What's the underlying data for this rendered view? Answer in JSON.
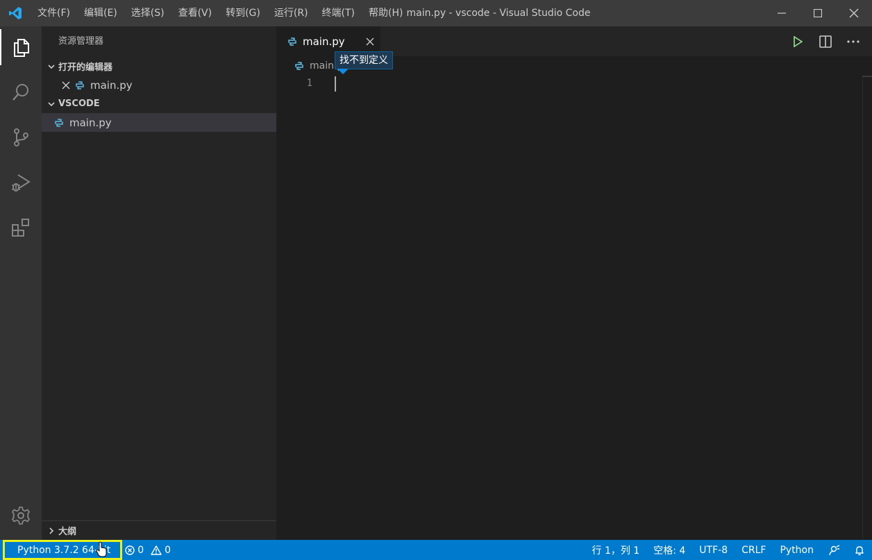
{
  "titlebar": {
    "menu": [
      "文件(F)",
      "编辑(E)",
      "选择(S)",
      "查看(V)",
      "转到(G)",
      "运行(R)",
      "终端(T)",
      "帮助(H)"
    ],
    "window_title": "main.py - vscode - Visual Studio Code"
  },
  "sidebar": {
    "title": "资源管理器",
    "open_editors": {
      "header": "打开的编辑器",
      "files": [
        "main.py"
      ]
    },
    "folder": {
      "header": "VSCODE",
      "files": [
        "main.py"
      ]
    },
    "outline_header": "大纲"
  },
  "editor": {
    "tab_label": "main.py",
    "breadcrumb": "main.py",
    "line_number": "1",
    "tooltip": "找不到定义"
  },
  "statusbar": {
    "interpreter": "Python 3.7.2 64-bit",
    "errors": "0",
    "warnings": "0",
    "position": "行 1，列 1",
    "spaces": "空格: 4",
    "encoding": "UTF-8",
    "eol": "CRLF",
    "language": "Python"
  },
  "colors": {
    "accent": "#007acc",
    "highlight": "#e6f21a",
    "run": "#89d185",
    "python_icon": "#519aba"
  },
  "icons": {
    "activity": [
      "explorer-icon",
      "search-icon",
      "source-control-icon",
      "run-debug-icon",
      "extensions-icon",
      "settings-gear-icon"
    ],
    "editor_actions": [
      "run-icon",
      "split-editor-icon",
      "more-actions-icon"
    ],
    "status": [
      "error-icon",
      "warning-icon",
      "feedback-icon",
      "bell-icon"
    ]
  }
}
